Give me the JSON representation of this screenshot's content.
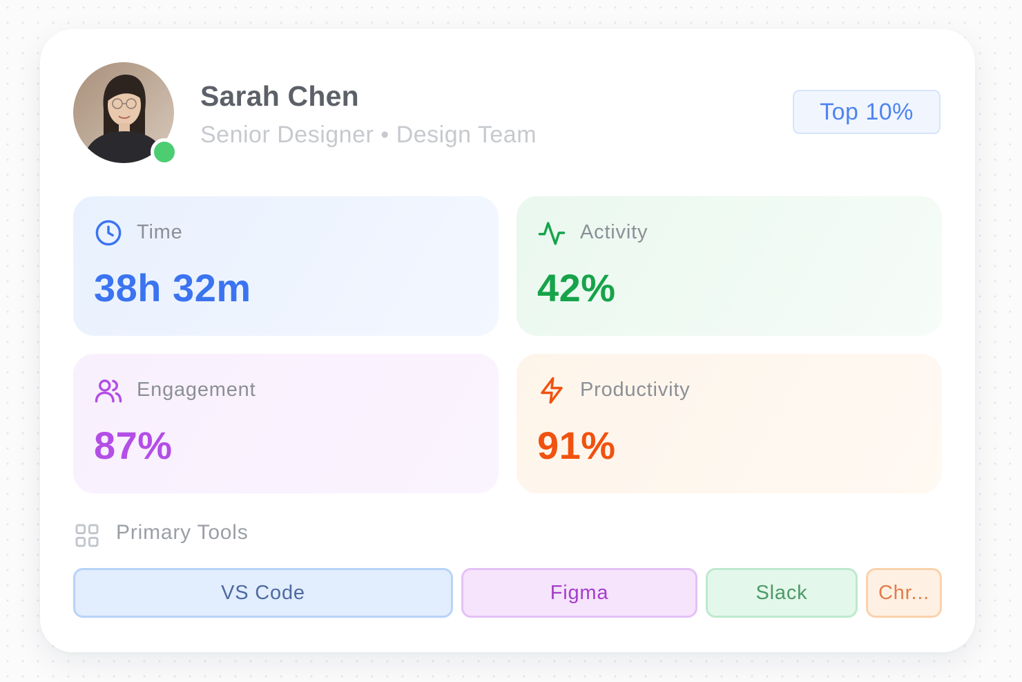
{
  "profile": {
    "name": "Sarah Chen",
    "role": "Senior Designer",
    "separator": "•",
    "team": "Design Team",
    "status": "online",
    "badge": "Top 10%"
  },
  "stats": {
    "time": {
      "label": "Time",
      "value": "38h 32m",
      "icon": "clock-icon",
      "color": "#3b74f0"
    },
    "activity": {
      "label": "Activity",
      "value": "42%",
      "icon": "activity-icon",
      "color": "#16a34a"
    },
    "engagement": {
      "label": "Engagement",
      "value": "87%",
      "icon": "users-icon",
      "color": "#b34ee6"
    },
    "productivity": {
      "label": "Productivity",
      "value": "91%",
      "icon": "zap-icon",
      "color": "#f0520f"
    }
  },
  "tools": {
    "label": "Primary Tools",
    "icon": "grid-icon",
    "items": [
      {
        "label": "VS Code"
      },
      {
        "label": "Figma"
      },
      {
        "label": "Slack"
      },
      {
        "label": "Chr..."
      }
    ]
  }
}
